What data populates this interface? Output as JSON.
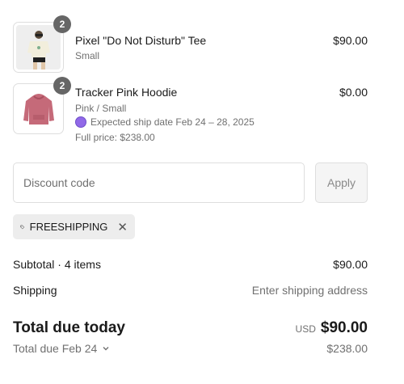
{
  "line_items": [
    {
      "title": "Pixel \"Do Not Disturb\" Tee",
      "variant": "Small",
      "price": "$90.00",
      "quantity": "2"
    },
    {
      "title": "Tracker Pink Hoodie",
      "variant": "Pink / Small",
      "ship_note": "Expected ship date Feb 24 – 28, 2025",
      "full_price": "Full price: $238.00",
      "price": "$0.00",
      "quantity": "2"
    }
  ],
  "discount": {
    "placeholder": "Discount code",
    "apply_label": "Apply",
    "applied_code": "FREESHIPPING"
  },
  "summary": {
    "subtotal_label": "Subtotal · 4 items",
    "subtotal_value": "$90.00",
    "shipping_label": "Shipping",
    "shipping_value": "Enter shipping address",
    "total_label": "Total due today",
    "total_currency": "USD",
    "total_value": "$90.00",
    "later_label": "Total due Feb 24",
    "later_value": "$238.00"
  },
  "colors": {
    "ship_dot": "#9169e8",
    "quantity_badge": "#666666"
  }
}
